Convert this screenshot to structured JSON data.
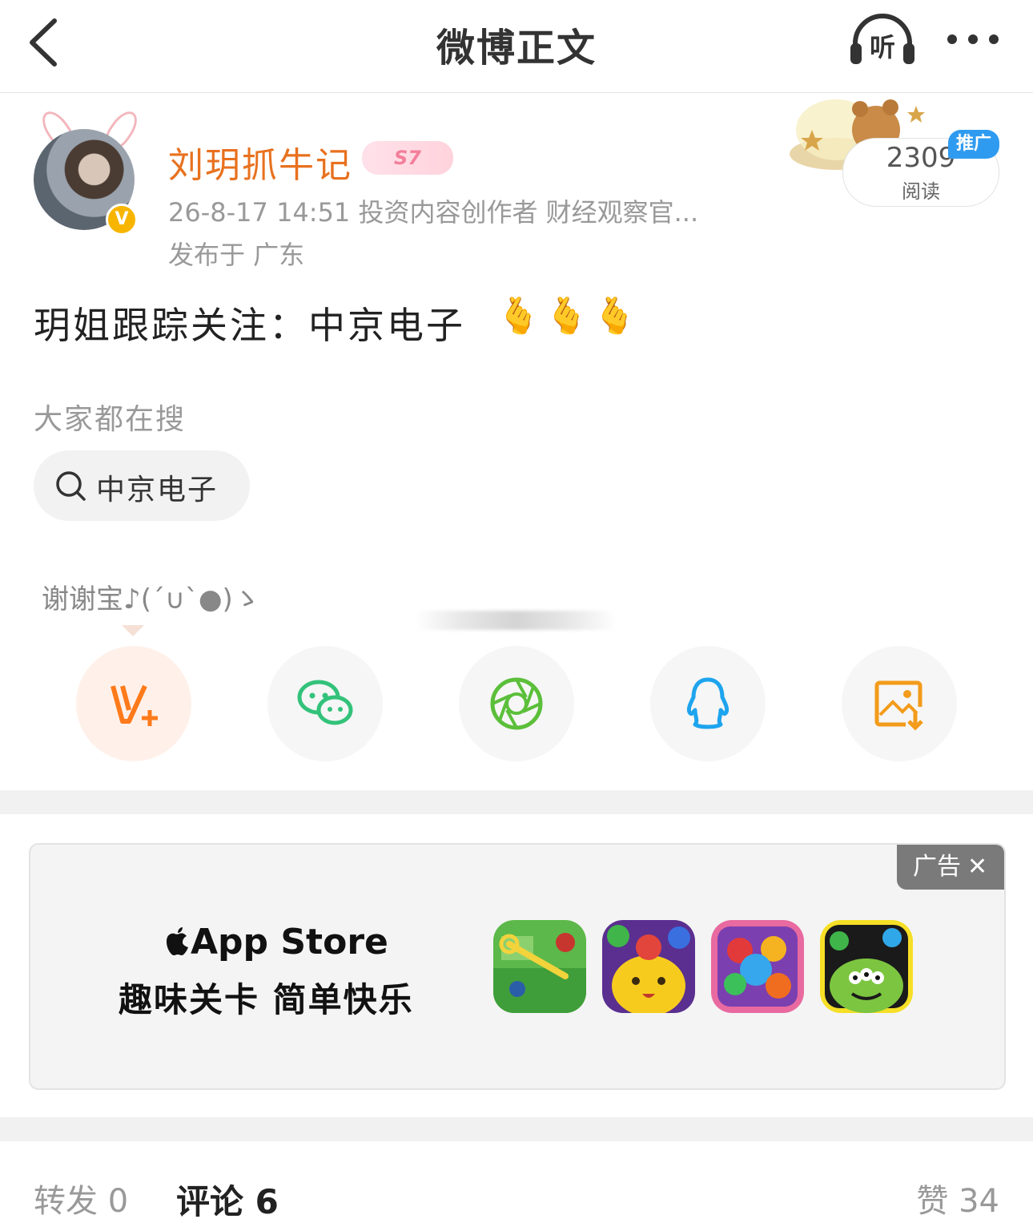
{
  "nav": {
    "title": "微博正文",
    "listen_label": "听"
  },
  "author": {
    "name": "刘玥抓牛记",
    "level_badge": "S7",
    "meta": "26-8-17 14:51  投资内容创作者 财经观察官...",
    "location": "发布于 广东",
    "verified_mark": "V"
  },
  "promo": {
    "read_count": "2309",
    "read_label": "阅读",
    "tag": "推广"
  },
  "post": {
    "text": "玥姐跟踪关注：中京电子",
    "emojis": [
      "🫰",
      "🫰",
      "🫰"
    ]
  },
  "search": {
    "label": "大家都在搜",
    "chip_text": "中京电子"
  },
  "thanks": {
    "text": "谢谢宝♪(´∪`●)ゝ"
  },
  "share": {
    "items": [
      {
        "name": "weibo-fan-icon",
        "color": "#ff7a1a"
      },
      {
        "name": "wechat-icon",
        "color": "#33c27a"
      },
      {
        "name": "moments-icon",
        "color": "#5bbf3a"
      },
      {
        "name": "qq-icon",
        "color": "#1ea4ee"
      },
      {
        "name": "save-image-icon",
        "color": "#f39b1a"
      }
    ]
  },
  "ad": {
    "tag": "广告",
    "close": "✕",
    "store": "App Store",
    "slogan": "趣味关卡 简单快乐"
  },
  "tabs": {
    "repost": "转发 0",
    "comment": "评论 6",
    "like": "赞 34"
  },
  "colors": {
    "accent": "#e8711f",
    "meta_gray": "#999999",
    "divider": "#f1f1f1",
    "promo_blue": "#2f9bf0"
  }
}
